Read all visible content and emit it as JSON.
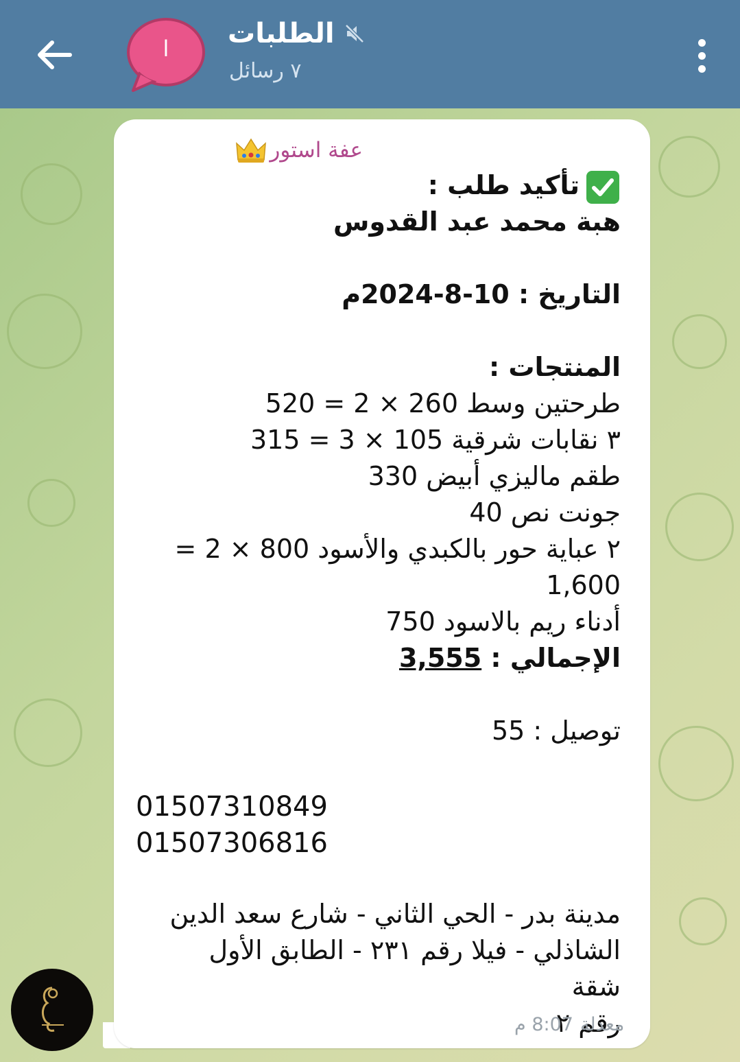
{
  "header": {
    "title": "الطلبات",
    "subtitle": "٧ رسائل",
    "avatar_text": "ا",
    "colors": {
      "bar": "#517da2",
      "avatar": "#e9558a"
    }
  },
  "message": {
    "sender": "عفة استور",
    "lines": {
      "confirm": "تأكيد طلب :",
      "customer": "هبة محمد عبد القدوس",
      "date_label": "التاريخ : 10-8-2024م",
      "products_label": "المنتجات :",
      "item1": "طرحتين وسط 260 × 2 = 520",
      "item2": "٣ نقابات شرقية 105 × 3 = 315",
      "item3": "طقم ماليزي أبيض 330",
      "item4": "جونت نص 40",
      "item5a": "٢ عباية حور بالكبدي والأسود 800 × 2 =",
      "item5b": "1,600",
      "item6": "أدناء ريم بالاسود 750",
      "total_label": "الإجمالي :",
      "total_value": "3,555",
      "delivery": "توصيل : 55"
    },
    "phones": [
      "01507310849",
      "01507306816"
    ],
    "address": [
      "مدينة بدر - الحي الثاني - شارع سعد الدين",
      "الشاذلي - فيلا رقم ٢٣١ - الطابق الأول شقة",
      "رقم ٢"
    ],
    "edited_label": "معدلة",
    "time": "8:07 م"
  }
}
